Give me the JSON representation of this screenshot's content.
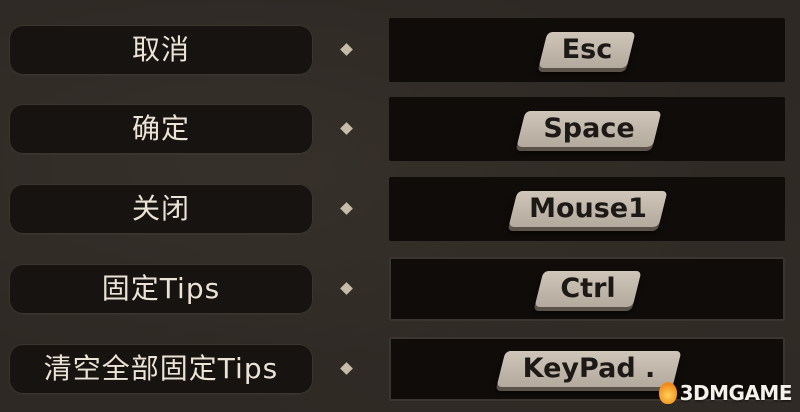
{
  "keybindings": [
    {
      "action": "取消",
      "key": "Esc"
    },
    {
      "action": "确定",
      "key": "Space"
    },
    {
      "action": "关闭",
      "key": "Mouse1"
    },
    {
      "action": "固定Tips",
      "key": "Ctrl"
    },
    {
      "action": "清空全部固定Tips",
      "key": "KeyPad ."
    }
  ],
  "watermark": {
    "text": "3DMGAME",
    "icon": "flame-logo-icon"
  },
  "colors": {
    "background": "#2e2924",
    "label_panel": "#171310",
    "key_slot": "#0f0c0a",
    "keycap": "#c3bbae",
    "text_light": "#ebe3d6",
    "text_dark": "#1c1916"
  }
}
